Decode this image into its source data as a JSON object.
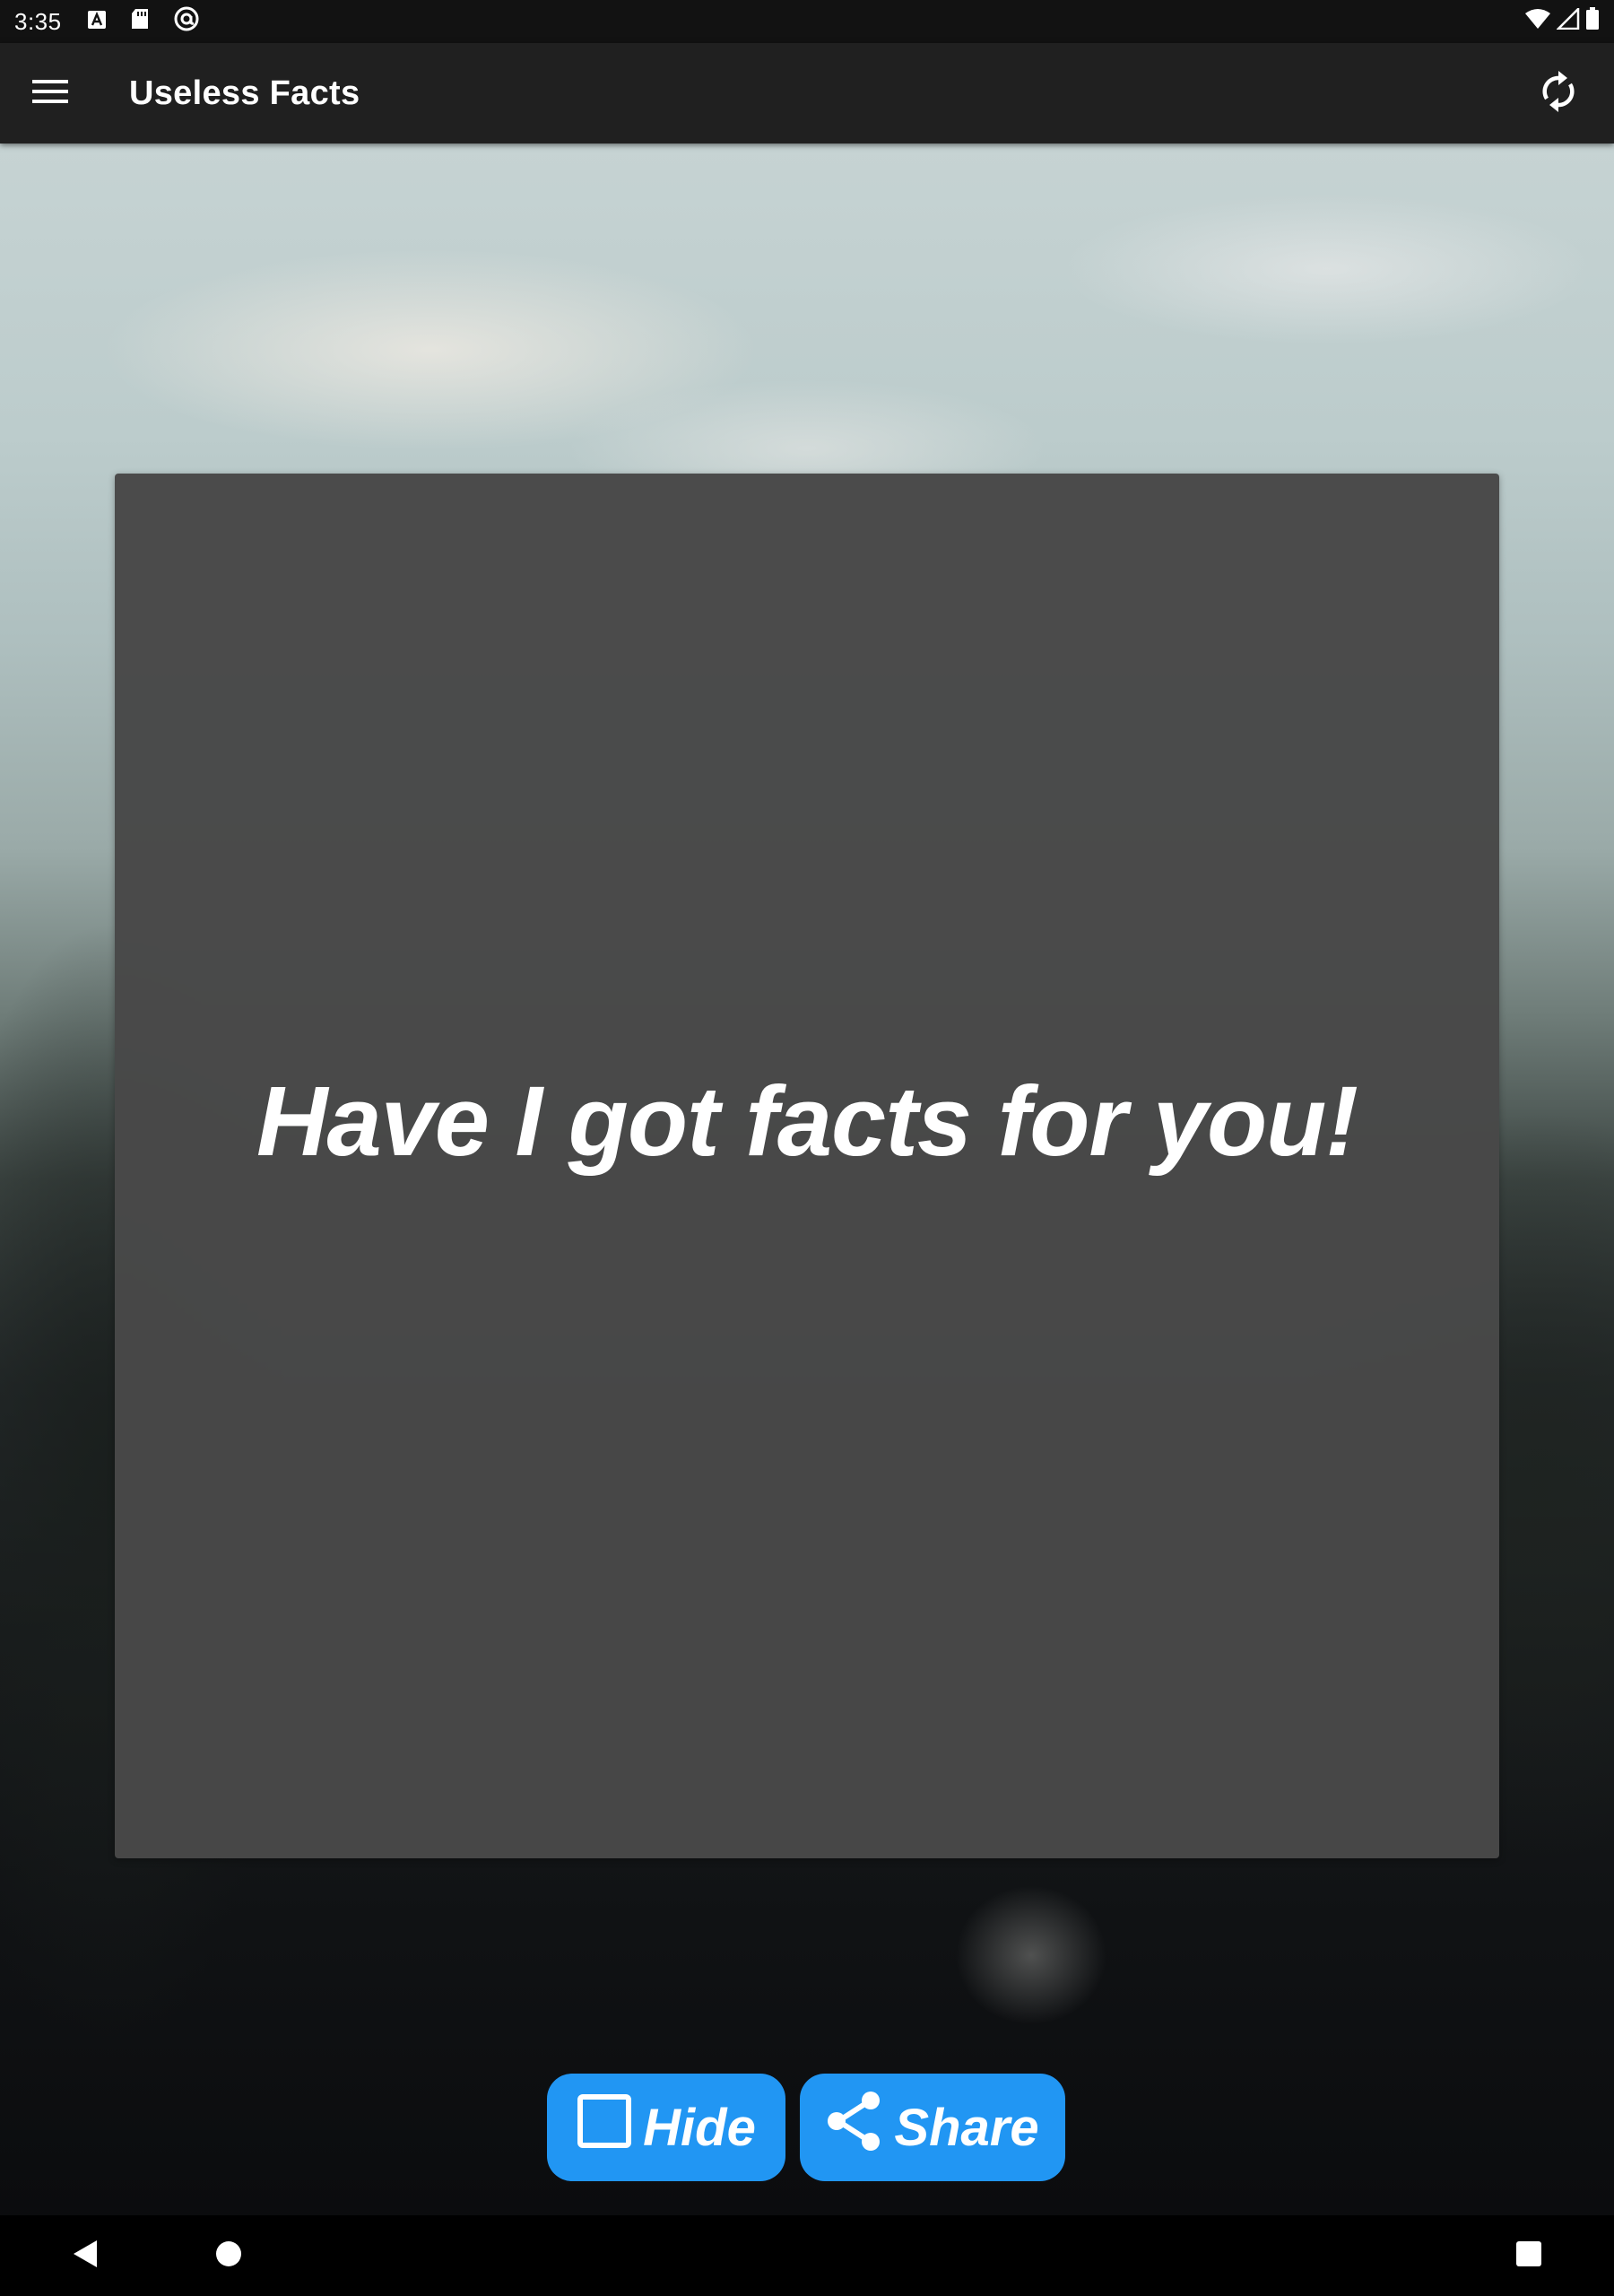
{
  "status_bar": {
    "time": "3:35",
    "left_icons": [
      "a-badge-icon",
      "sd-card-icon",
      "at-sign-icon"
    ],
    "right_icons": [
      "wifi-icon",
      "signal-icon",
      "battery-icon"
    ]
  },
  "app_bar": {
    "title": "Useless Facts",
    "menu_icon": "hamburger-menu-icon",
    "action_icon": "refresh-icon"
  },
  "card": {
    "text": "Have I got facts for you!"
  },
  "actions": {
    "hide_label": "Hide",
    "share_label": "Share"
  },
  "colors": {
    "status_bar": "#121212",
    "app_bar": "#202020",
    "card": "#484848",
    "button": "#2196f3",
    "text": "#ffffff"
  },
  "nav_bar": {
    "icons": [
      "back-icon",
      "home-icon",
      "recents-icon"
    ]
  }
}
